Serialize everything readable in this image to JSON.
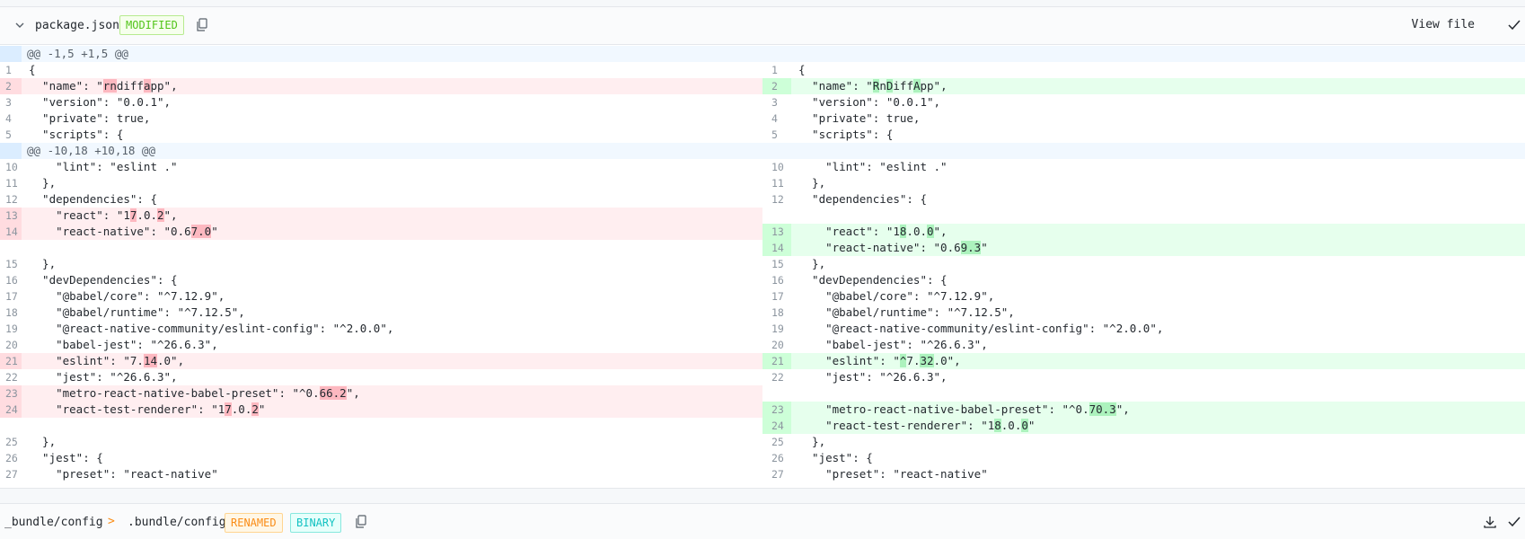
{
  "file1": {
    "name": "package.json",
    "status": "MODIFIED",
    "view_label": "View file",
    "icons": {
      "collapse": "chevron-down-icon",
      "copy": "copy-icon",
      "check": "check-icon"
    },
    "colors": {
      "modified": "#52c41a",
      "deleted_bg": "#ffeef0",
      "inserted_bg": "#e6ffed",
      "hunk_bg": "#f1f8ff"
    },
    "rows": [
      {
        "type": "hunk",
        "text": "@@ -1,5 +1,5 @@"
      },
      {
        "type": "line",
        "left": {
          "num": "1",
          "kind": "normal",
          "segs": [
            [
              "{",
              ""
            ]
          ]
        },
        "right": {
          "num": "1",
          "kind": "normal",
          "segs": [
            [
              "{",
              ""
            ]
          ]
        }
      },
      {
        "type": "line",
        "left": {
          "num": "2",
          "kind": "del",
          "segs": [
            [
              "  \"name\": \"",
              ""
            ],
            [
              "rn",
              "hl"
            ],
            [
              "diff",
              ""
            ],
            [
              "a",
              "hl"
            ],
            [
              "pp\",",
              ""
            ]
          ]
        },
        "right": {
          "num": "2",
          "kind": "ins",
          "segs": [
            [
              "  \"name\": \"",
              ""
            ],
            [
              "R",
              "hl"
            ],
            [
              "n",
              ""
            ],
            [
              "D",
              "hl"
            ],
            [
              "iff",
              ""
            ],
            [
              "A",
              "hl"
            ],
            [
              "pp\",",
              ""
            ]
          ]
        }
      },
      {
        "type": "line",
        "left": {
          "num": "3",
          "kind": "normal",
          "segs": [
            [
              "  \"version\": \"0.0.1\",",
              ""
            ]
          ]
        },
        "right": {
          "num": "3",
          "kind": "normal",
          "segs": [
            [
              "  \"version\": \"0.0.1\",",
              ""
            ]
          ]
        }
      },
      {
        "type": "line",
        "left": {
          "num": "4",
          "kind": "normal",
          "segs": [
            [
              "  \"private\": true,",
              ""
            ]
          ]
        },
        "right": {
          "num": "4",
          "kind": "normal",
          "segs": [
            [
              "  \"private\": true,",
              ""
            ]
          ]
        }
      },
      {
        "type": "line",
        "left": {
          "num": "5",
          "kind": "normal",
          "segs": [
            [
              "  \"scripts\": {",
              ""
            ]
          ]
        },
        "right": {
          "num": "5",
          "kind": "normal",
          "segs": [
            [
              "  \"scripts\": {",
              ""
            ]
          ]
        }
      },
      {
        "type": "hunk",
        "text": "@@ -10,18 +10,18 @@"
      },
      {
        "type": "line",
        "left": {
          "num": "10",
          "kind": "normal",
          "segs": [
            [
              "    \"lint\": \"eslint .\"",
              ""
            ]
          ]
        },
        "right": {
          "num": "10",
          "kind": "normal",
          "segs": [
            [
              "    \"lint\": \"eslint .\"",
              ""
            ]
          ]
        }
      },
      {
        "type": "line",
        "left": {
          "num": "11",
          "kind": "normal",
          "segs": [
            [
              "  },",
              ""
            ]
          ]
        },
        "right": {
          "num": "11",
          "kind": "normal",
          "segs": [
            [
              "  },",
              ""
            ]
          ]
        }
      },
      {
        "type": "line",
        "left": {
          "num": "12",
          "kind": "normal",
          "segs": [
            [
              "  \"dependencies\": {",
              ""
            ]
          ]
        },
        "right": {
          "num": "12",
          "kind": "normal",
          "segs": [
            [
              "  \"dependencies\": {",
              ""
            ]
          ]
        }
      },
      {
        "type": "line",
        "left": {
          "num": "13",
          "kind": "del",
          "segs": [
            [
              "    \"react\": \"1",
              ""
            ],
            [
              "7",
              "hl"
            ],
            [
              ".0.",
              ""
            ],
            [
              "2",
              "hl"
            ],
            [
              "\",",
              ""
            ]
          ]
        },
        "right": {
          "num": "",
          "kind": "empty",
          "segs": []
        }
      },
      {
        "type": "line",
        "left": {
          "num": "14",
          "kind": "del",
          "segs": [
            [
              "    \"react-native\": \"0.6",
              ""
            ],
            [
              "7.0",
              "hl"
            ],
            [
              "\"",
              ""
            ]
          ]
        },
        "right": {
          "num": "13",
          "kind": "ins",
          "segs": [
            [
              "    \"react\": \"1",
              ""
            ],
            [
              "8",
              "hl"
            ],
            [
              ".0.",
              ""
            ],
            [
              "0",
              "hl"
            ],
            [
              "\",",
              ""
            ]
          ]
        }
      },
      {
        "type": "line",
        "left": {
          "num": "",
          "kind": "empty",
          "segs": []
        },
        "right": {
          "num": "14",
          "kind": "ins",
          "segs": [
            [
              "    \"react-native\": \"0.6",
              ""
            ],
            [
              "9.3",
              "hl"
            ],
            [
              "\"",
              ""
            ]
          ]
        }
      },
      {
        "type": "line",
        "left": {
          "num": "15",
          "kind": "normal",
          "segs": [
            [
              "  },",
              ""
            ]
          ]
        },
        "right": {
          "num": "15",
          "kind": "normal",
          "segs": [
            [
              "  },",
              ""
            ]
          ]
        }
      },
      {
        "type": "line",
        "left": {
          "num": "16",
          "kind": "normal",
          "segs": [
            [
              "  \"devDependencies\": {",
              ""
            ]
          ]
        },
        "right": {
          "num": "16",
          "kind": "normal",
          "segs": [
            [
              "  \"devDependencies\": {",
              ""
            ]
          ]
        }
      },
      {
        "type": "line",
        "left": {
          "num": "17",
          "kind": "normal",
          "segs": [
            [
              "    \"@babel/core\": \"^7.12.9\",",
              ""
            ]
          ]
        },
        "right": {
          "num": "17",
          "kind": "normal",
          "segs": [
            [
              "    \"@babel/core\": \"^7.12.9\",",
              ""
            ]
          ]
        }
      },
      {
        "type": "line",
        "left": {
          "num": "18",
          "kind": "normal",
          "segs": [
            [
              "    \"@babel/runtime\": \"^7.12.5\",",
              ""
            ]
          ]
        },
        "right": {
          "num": "18",
          "kind": "normal",
          "segs": [
            [
              "    \"@babel/runtime\": \"^7.12.5\",",
              ""
            ]
          ]
        }
      },
      {
        "type": "line",
        "left": {
          "num": "19",
          "kind": "normal",
          "segs": [
            [
              "    \"@react-native-community/eslint-config\": \"^2.0.0\",",
              ""
            ]
          ]
        },
        "right": {
          "num": "19",
          "kind": "normal",
          "segs": [
            [
              "    \"@react-native-community/eslint-config\": \"^2.0.0\",",
              ""
            ]
          ]
        }
      },
      {
        "type": "line",
        "left": {
          "num": "20",
          "kind": "normal",
          "segs": [
            [
              "    \"babel-jest\": \"^26.6.3\",",
              ""
            ]
          ]
        },
        "right": {
          "num": "20",
          "kind": "normal",
          "segs": [
            [
              "    \"babel-jest\": \"^26.6.3\",",
              ""
            ]
          ]
        }
      },
      {
        "type": "line",
        "left": {
          "num": "21",
          "kind": "del",
          "segs": [
            [
              "    \"eslint\": \"7.",
              ""
            ],
            [
              "14",
              "hl"
            ],
            [
              ".0\",",
              ""
            ]
          ]
        },
        "right": {
          "num": "21",
          "kind": "ins",
          "segs": [
            [
              "    \"eslint\": \"",
              ""
            ],
            [
              "^",
              "hl"
            ],
            [
              "7.",
              ""
            ],
            [
              "32",
              "hl"
            ],
            [
              ".0\",",
              ""
            ]
          ]
        }
      },
      {
        "type": "line",
        "left": {
          "num": "22",
          "kind": "normal",
          "segs": [
            [
              "    \"jest\": \"^26.6.3\",",
              ""
            ]
          ]
        },
        "right": {
          "num": "22",
          "kind": "normal",
          "segs": [
            [
              "    \"jest\": \"^26.6.3\",",
              ""
            ]
          ]
        }
      },
      {
        "type": "line",
        "left": {
          "num": "23",
          "kind": "del",
          "segs": [
            [
              "    \"metro-react-native-babel-preset\": \"^0.",
              ""
            ],
            [
              "66.2",
              "hl"
            ],
            [
              "\",",
              ""
            ]
          ]
        },
        "right": {
          "num": "",
          "kind": "empty",
          "segs": []
        }
      },
      {
        "type": "line",
        "left": {
          "num": "24",
          "kind": "del",
          "segs": [
            [
              "    \"react-test-renderer\": \"1",
              ""
            ],
            [
              "7",
              "hl"
            ],
            [
              ".0.",
              ""
            ],
            [
              "2",
              "hl"
            ],
            [
              "\"",
              ""
            ]
          ]
        },
        "right": {
          "num": "23",
          "kind": "ins",
          "segs": [
            [
              "    \"metro-react-native-babel-preset\": \"^0.",
              ""
            ],
            [
              "70.3",
              "hl"
            ],
            [
              "\",",
              ""
            ]
          ]
        }
      },
      {
        "type": "line",
        "left": {
          "num": "",
          "kind": "empty",
          "segs": []
        },
        "right": {
          "num": "24",
          "kind": "ins",
          "segs": [
            [
              "    \"react-test-renderer\": \"1",
              ""
            ],
            [
              "8",
              "hl"
            ],
            [
              ".0.",
              ""
            ],
            [
              "0",
              "hl"
            ],
            [
              "\"",
              ""
            ]
          ]
        }
      },
      {
        "type": "line",
        "left": {
          "num": "25",
          "kind": "normal",
          "segs": [
            [
              "  },",
              ""
            ]
          ]
        },
        "right": {
          "num": "25",
          "kind": "normal",
          "segs": [
            [
              "  },",
              ""
            ]
          ]
        }
      },
      {
        "type": "line",
        "left": {
          "num": "26",
          "kind": "normal",
          "segs": [
            [
              "  \"jest\": {",
              ""
            ]
          ]
        },
        "right": {
          "num": "26",
          "kind": "normal",
          "segs": [
            [
              "  \"jest\": {",
              ""
            ]
          ]
        }
      },
      {
        "type": "line",
        "left": {
          "num": "27",
          "kind": "normal",
          "segs": [
            [
              "    \"preset\": \"react-native\"",
              ""
            ]
          ]
        },
        "right": {
          "num": "27",
          "kind": "normal",
          "segs": [
            [
              "    \"preset\": \"react-native\"",
              ""
            ]
          ]
        }
      }
    ]
  },
  "file2": {
    "old_name": "_bundle/config",
    "arrow": ">",
    "new_name": ".bundle/config",
    "status_renamed": "RENAMED",
    "status_binary": "BINARY",
    "icons": {
      "copy": "copy-icon",
      "download": "download-icon",
      "check": "check-icon"
    },
    "colors": {
      "renamed": "#fa8c16",
      "binary": "#13c2c2"
    }
  }
}
